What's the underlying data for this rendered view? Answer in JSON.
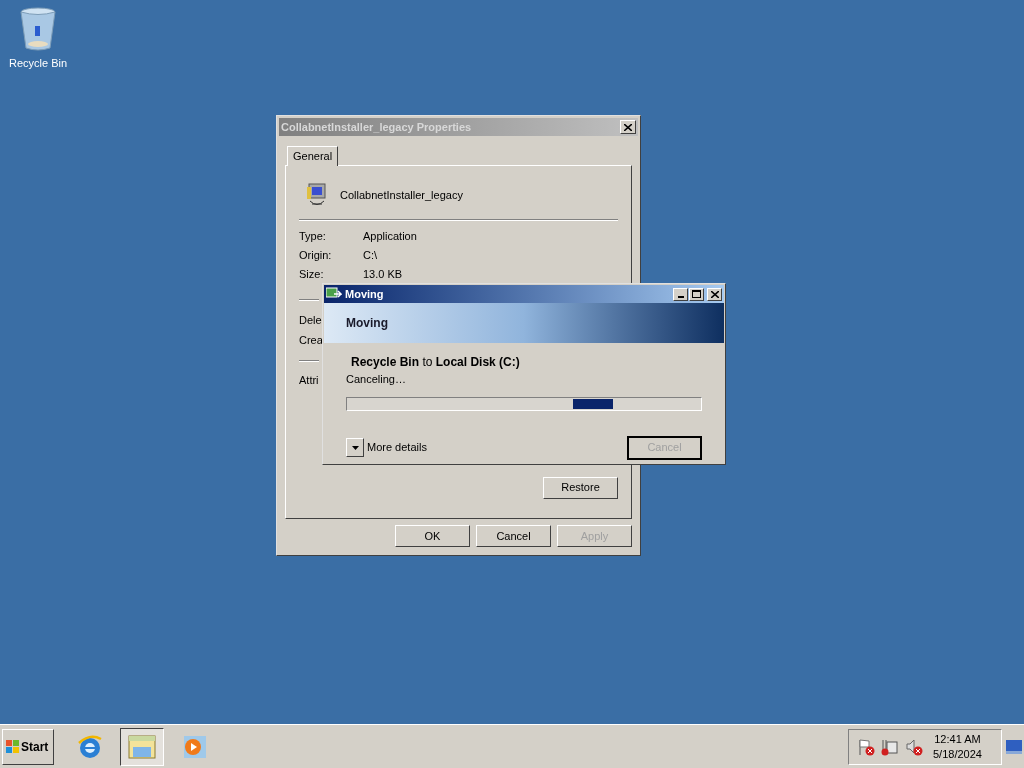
{
  "desktop": {
    "icons": [
      {
        "label": "Recycle Bin"
      }
    ]
  },
  "properties_window": {
    "title": "CollabnetInstaller_legacy Properties",
    "tabs": [
      {
        "label": "General",
        "selected": true
      }
    ],
    "file_name": "CollabnetInstaller_legacy",
    "fields": [
      {
        "label": "Type:",
        "value": "Application"
      },
      {
        "label": "Origin:",
        "value": "C:\\"
      },
      {
        "label": "Size:",
        "value": "13.0 KB"
      }
    ],
    "hidden_labels": [
      "Dele",
      "Crea"
    ],
    "attributes_label": "Attri",
    "restore_button": "Restore",
    "buttons": [
      {
        "label": "OK",
        "disabled": false
      },
      {
        "label": "Cancel",
        "disabled": false
      },
      {
        "label": "Apply",
        "disabled": true
      }
    ]
  },
  "progress_dialog": {
    "title": "Moving",
    "heading": "Moving",
    "route": "**Recycle Bin** to **Local Disk (C:)**",
    "status": "Canceling…",
    "more_details": "More details",
    "cancel": {
      "label": "Cancel",
      "disabled": true
    }
  },
  "taskbar": {
    "start": "Start",
    "apps": [
      {
        "kind": "browser",
        "selected": false
      },
      {
        "kind": "explorer",
        "selected": true
      },
      {
        "kind": "media",
        "selected": false
      }
    ],
    "clock": {
      "time": "12:41 AM",
      "date": "5/18/2024"
    }
  }
}
